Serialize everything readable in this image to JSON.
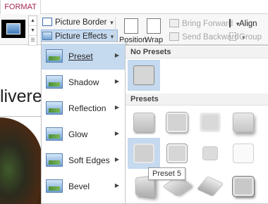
{
  "ribbon": {
    "active_tab": "FORMAT",
    "picture_border": "Picture Border",
    "picture_effects": "Picture Effects",
    "position": "Position",
    "wrap": "Wrap",
    "bring_forward": "Bring Forward",
    "send_backward": "Send Backward",
    "align": "Align",
    "group": "Group"
  },
  "document": {
    "text": "livere"
  },
  "effects_menu": {
    "items": [
      {
        "label": "Preset",
        "icon": "preset-effect-icon"
      },
      {
        "label": "Shadow",
        "icon": "shadow-effect-icon"
      },
      {
        "label": "Reflection",
        "icon": "reflection-effect-icon"
      },
      {
        "label": "Glow",
        "icon": "glow-effect-icon"
      },
      {
        "label": "Soft Edges",
        "icon": "soft-edges-effect-icon"
      },
      {
        "label": "Bevel",
        "icon": "bevel-effect-icon"
      }
    ]
  },
  "presets_panel": {
    "no_presets_header": "No Presets",
    "presets_header": "Presets",
    "tooltip": "Preset 5"
  },
  "colors": {
    "accent": "#a4244f",
    "hover_highlight": "#c5d9ef"
  }
}
